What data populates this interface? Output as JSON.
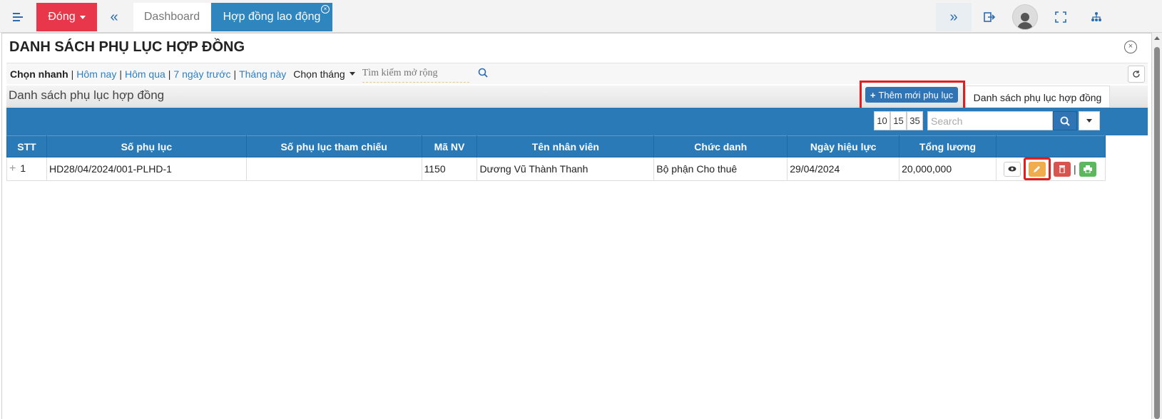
{
  "topbar": {
    "close_label": "Đóng",
    "tab_dashboard": "Dashboard",
    "tab_active": "Hợp đồng lao động"
  },
  "panel": {
    "title": "DANH SÁCH PHỤ LỤC HỢP ĐỒNG"
  },
  "filters": {
    "quick_label": "Chọn nhanh",
    "today": "Hôm nay",
    "yesterday": "Hôm qua",
    "last7": "7 ngày trước",
    "this_month": "Tháng này",
    "month_select": "Chọn tháng",
    "search_placeholder": "Tìm kiếm mở rộng"
  },
  "list": {
    "title": "Danh sách phụ lục hợp đồng",
    "add_button": "Thêm mới phụ lục",
    "crumb_tab": "Danh sách phụ lục hợp đồng"
  },
  "grid": {
    "page_sizes": [
      "10",
      "15",
      "35"
    ],
    "search_placeholder": "Search",
    "columns": [
      "STT",
      "Số phụ lục",
      "Số phụ lục tham chiếu",
      "Mã NV",
      "Tên nhân viên",
      "Chức danh",
      "Ngày hiệu lực",
      "Tổng lương",
      ""
    ],
    "rows": [
      {
        "stt": "1",
        "so_phu_luc": "HD28/04/2024/001-PLHD-1",
        "tham_chieu": "",
        "ma_nv": "1150",
        "ten": "Dương Vũ Thành Thanh",
        "chuc_danh": "Bộ phận Cho thuê",
        "ngay": "29/04/2024",
        "luong": "20,000,000"
      }
    ]
  },
  "colors": {
    "primary": "#2a7ab8",
    "danger": "#e8374a",
    "highlight": "#e02020",
    "edit": "#f0ad4e",
    "delete": "#d9534f",
    "print": "#5cb85c"
  }
}
